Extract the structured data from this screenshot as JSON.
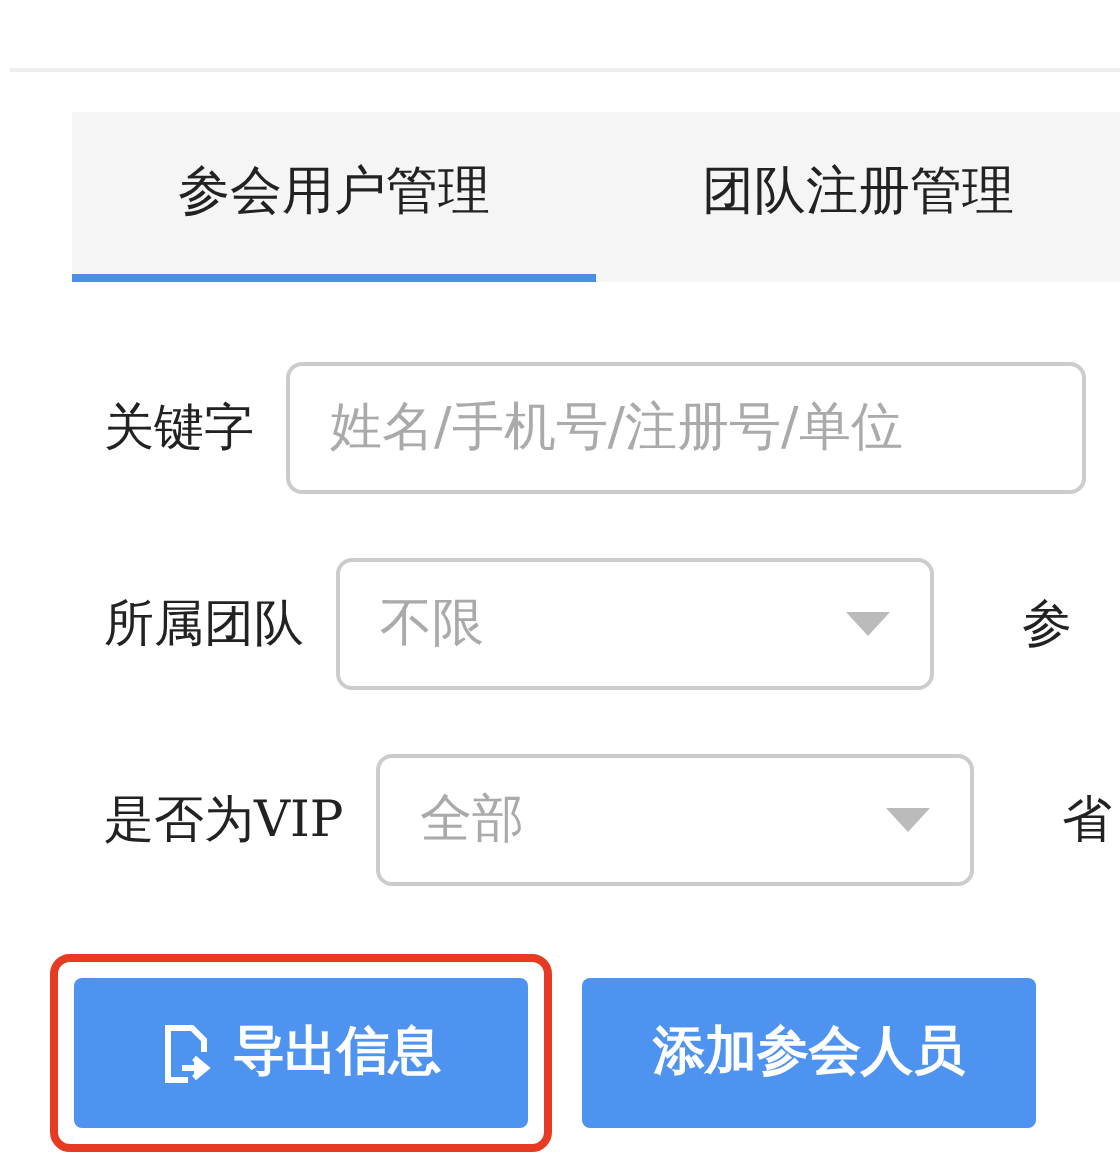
{
  "tabs": [
    {
      "label": "参会用户管理",
      "selected": true
    },
    {
      "label": "团队注册管理",
      "selected": false
    }
  ],
  "filters": [
    {
      "kind": "text",
      "label": "关键字",
      "placeholder": "姓名/手机号/注册号/单位"
    },
    {
      "kind": "select",
      "label": "所属团队",
      "value": "不限",
      "next_label": "参"
    },
    {
      "kind": "select",
      "label": "是否为VIP",
      "value": "全部",
      "next_label": "省"
    }
  ],
  "buttons": [
    {
      "kind": "export",
      "label": "导出信息",
      "highlighted": true
    },
    {
      "kind": "plain",
      "label": "添加参会人员"
    }
  ]
}
